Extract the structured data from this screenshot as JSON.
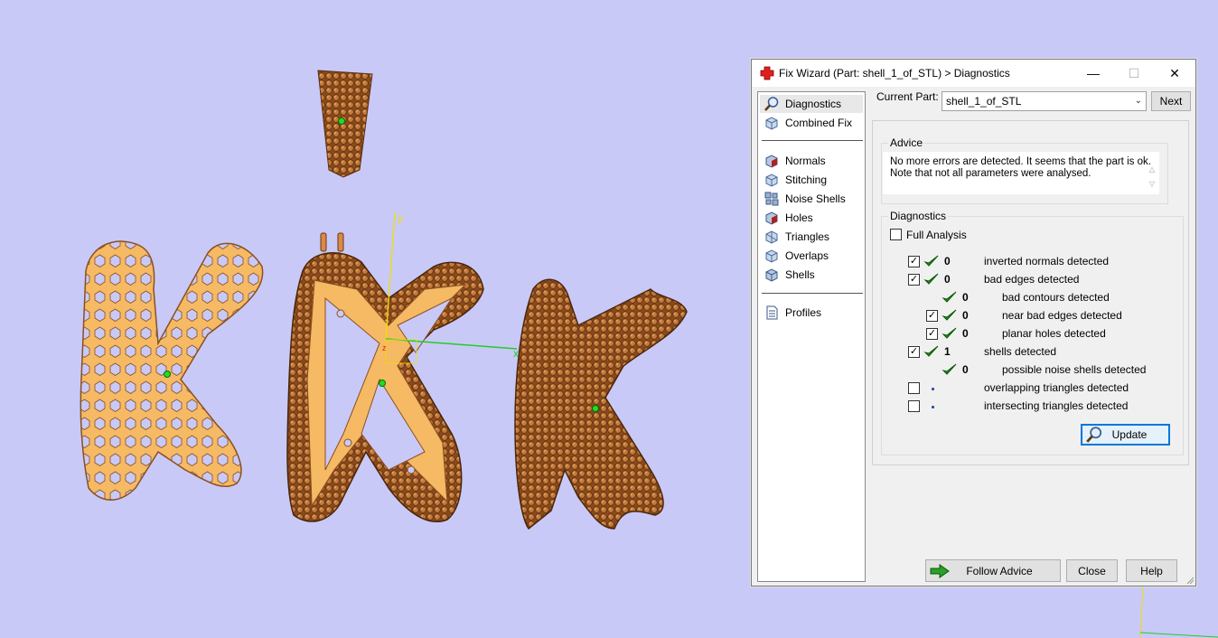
{
  "dialog": {
    "title": "Fix Wizard (Part: shell_1_of_STL) > Diagnostics",
    "window_buttons": {
      "minimize": "—",
      "maximize": "☐",
      "close": "✕"
    }
  },
  "nav": {
    "items": [
      {
        "label": "Diagnostics",
        "icon": "magnifier-icon",
        "selected": true
      },
      {
        "label": "Combined Fix",
        "icon": "cube-icon"
      },
      {
        "label": "Normals",
        "icon": "normals-cube-icon"
      },
      {
        "label": "Stitching",
        "icon": "stitching-cube-icon"
      },
      {
        "label": "Noise Shells",
        "icon": "noise-shells-icon"
      },
      {
        "label": "Holes",
        "icon": "holes-cube-icon"
      },
      {
        "label": "Triangles",
        "icon": "triangles-cube-icon"
      },
      {
        "label": "Overlaps",
        "icon": "overlaps-cube-icon"
      },
      {
        "label": "Shells",
        "icon": "shells-cube-icon"
      },
      {
        "label": "Profiles",
        "icon": "document-icon"
      }
    ]
  },
  "current_part": {
    "label": "Current Part:",
    "value": "shell_1_of_STL",
    "next_label": "Next"
  },
  "advice": {
    "title": "Advice",
    "text_line1": "No more errors are detected. It seems that the part is ok.",
    "text_line2": "Note that not all parameters were analysed."
  },
  "diagnostics": {
    "title": "Diagnostics",
    "full_analysis_label": "Full Analysis",
    "rows": [
      {
        "checked": true,
        "has_checkbox": true,
        "status": "ok",
        "count": "0",
        "label": "inverted normals detected"
      },
      {
        "checked": true,
        "has_checkbox": true,
        "status": "ok",
        "count": "0",
        "label": "bad edges detected"
      },
      {
        "checked": false,
        "has_checkbox": false,
        "status": "ok",
        "count": "0",
        "label": "bad contours detected"
      },
      {
        "checked": true,
        "has_checkbox": true,
        "status": "ok",
        "count": "0",
        "label": "near bad edges detected"
      },
      {
        "checked": true,
        "has_checkbox": true,
        "status": "ok",
        "count": "0",
        "label": "planar holes detected"
      },
      {
        "checked": true,
        "has_checkbox": true,
        "status": "ok",
        "count": "1",
        "label": "shells detected"
      },
      {
        "checked": false,
        "has_checkbox": false,
        "status": "ok",
        "count": "0",
        "label": "possible noise shells detected"
      },
      {
        "checked": false,
        "has_checkbox": true,
        "status": "none",
        "count": "",
        "label": "overlapping triangles detected"
      },
      {
        "checked": false,
        "has_checkbox": true,
        "status": "none",
        "count": "",
        "label": "intersecting triangles detected"
      }
    ],
    "update_label": "Update"
  },
  "footer": {
    "follow_advice_label": "Follow Advice",
    "close_label": "Close",
    "help_label": "Help"
  },
  "viewport": {
    "axis_y_label": "y",
    "axis_x_label": "x",
    "axis_z_label": "z",
    "colors": {
      "background": "#c9c9f8",
      "part_light": "#f5b862",
      "part_dark": "#b86a2c",
      "axis_y": "#f0e000",
      "axis_x": "#22cc22"
    }
  }
}
